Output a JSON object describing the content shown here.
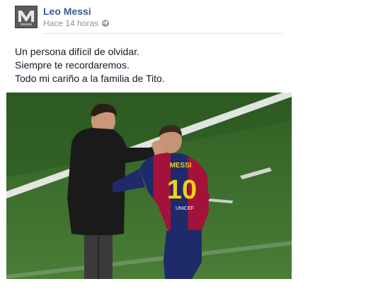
{
  "post": {
    "author": "Leo Messi",
    "timestamp": "Hace 14 horas",
    "audience_icon": "globe-icon",
    "message_lines": [
      "Un persona difícil de olvidar.",
      "Siempre te recordaremos.",
      "Todo mi cariño a la familia de Tito."
    ],
    "photo": {
      "jersey_name": "MESSI",
      "jersey_number": "10",
      "sponsor": "UNICEF"
    }
  },
  "colors": {
    "link": "#3b5998",
    "meta": "#90949c",
    "pitch": "#3f7330",
    "jersey_blue": "#1f2a6b",
    "jersey_red": "#a3123a",
    "number_yellow": "#f2d11a"
  }
}
